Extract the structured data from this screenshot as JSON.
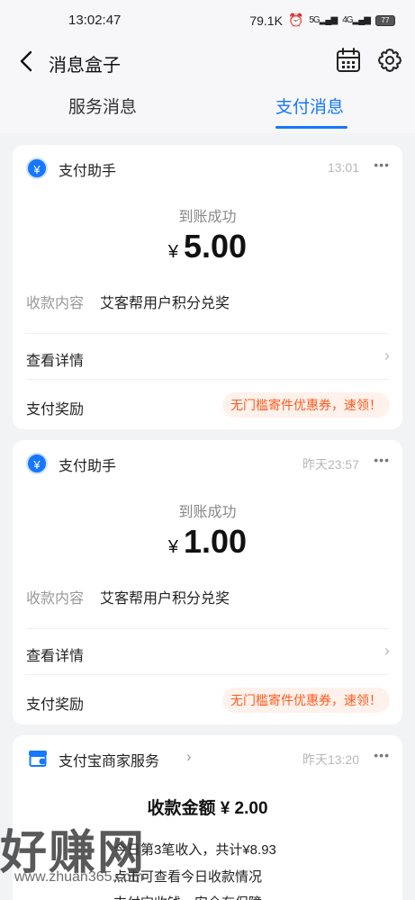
{
  "status_bar": {
    "time": "13:02:47",
    "speed": "79.1K",
    "signal1": "5G",
    "signal2": "4G",
    "battery": "77"
  },
  "nav": {
    "title": "消息盒子"
  },
  "tabs": [
    {
      "label": "服务消息",
      "active": false
    },
    {
      "label": "支付消息",
      "active": true
    }
  ],
  "accent_color": "#1677ff",
  "promo_color": "#ff5a1f",
  "cards": [
    {
      "app_name": "支付助手",
      "time": "13:01",
      "more": "•••",
      "status": "到账成功",
      "currency": "¥",
      "amount": "5.00",
      "content_label": "收款内容",
      "content_value": "艾客帮用户积分兑奖",
      "details_label": "查看详情",
      "reward_label": "支付奖励",
      "promo": "无门槛寄件优惠券，速领！"
    },
    {
      "app_name": "支付助手",
      "time": "昨天23:57",
      "more": "•••",
      "status": "到账成功",
      "currency": "¥",
      "amount": "1.00",
      "content_label": "收款内容",
      "content_value": "艾客帮用户积分兑奖",
      "details_label": "查看详情",
      "reward_label": "支付奖励",
      "promo": "无门槛寄件优惠券，速领！"
    }
  ],
  "merchant_card": {
    "app_name": "支付宝商家服务",
    "time": "昨天13:20",
    "more": "•••",
    "total": "收款金额 ¥ 2.00",
    "line1": "今日第3笔收入，共计¥8.93",
    "line2": "点击可查看今日收款情况",
    "line3": "支付宝收钱，安全有保障"
  },
  "watermark": {
    "main": "好赚网",
    "sub": "www.zhuan365.com"
  }
}
